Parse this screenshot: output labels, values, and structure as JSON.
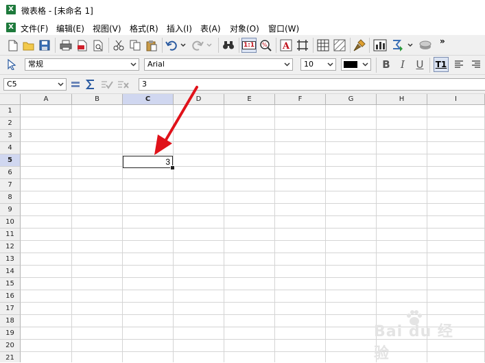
{
  "window": {
    "title": "微表格 - [未命名 1]",
    "app_icon_letter": "X"
  },
  "menu": [
    {
      "label": "文件(F)"
    },
    {
      "label": "编辑(E)"
    },
    {
      "label": "视图(V)"
    },
    {
      "label": "格式(R)"
    },
    {
      "label": "插入(I)"
    },
    {
      "label": "表(A)"
    },
    {
      "label": "对象(O)"
    },
    {
      "label": "窗口(W)"
    }
  ],
  "toolbar": {
    "more_glyph": "»",
    "zoom_label": "1:1"
  },
  "format_bar": {
    "style_value": "常规",
    "font_value": "Arial",
    "size_value": "10",
    "bold_label": "B",
    "italic_label": "I",
    "underline_label": "U",
    "text_type_label": "T1",
    "color": "#000000"
  },
  "formula_bar": {
    "cell_ref": "C5",
    "content": "3"
  },
  "sheet": {
    "columns": [
      "A",
      "B",
      "C",
      "D",
      "E",
      "F",
      "G",
      "H",
      "I"
    ],
    "rows": [
      "1",
      "2",
      "3",
      "4",
      "5",
      "6",
      "7",
      "8",
      "9",
      "10",
      "11",
      "12",
      "13",
      "14",
      "15",
      "16",
      "17",
      "18",
      "19",
      "20",
      "21"
    ],
    "active_column": "C",
    "active_row": "5",
    "selected_cell_value": "3"
  },
  "watermark": {
    "text": "Bai du 经验"
  },
  "colors": {
    "accent_arrow": "#e0121a",
    "selection_header": "#d0d7f0",
    "app_icon": "#1e7a3c"
  }
}
